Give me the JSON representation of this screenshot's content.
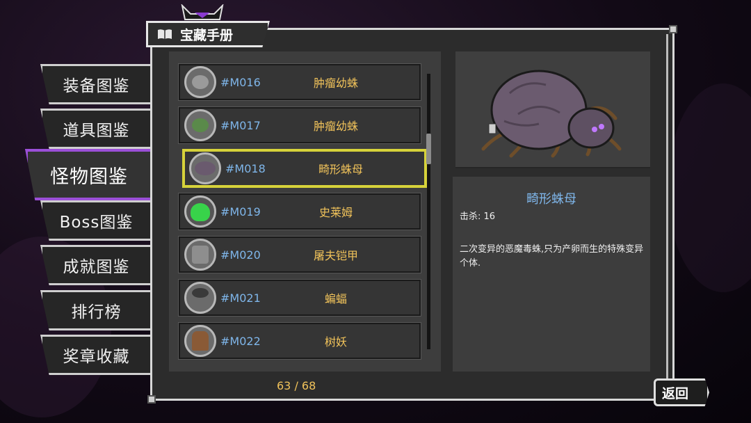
{
  "header": {
    "title": "宝藏手册",
    "icon": "book-icon"
  },
  "sidebar": {
    "items": [
      {
        "label": "装备图鉴",
        "active": false
      },
      {
        "label": "道具图鉴",
        "active": false
      },
      {
        "label": "怪物图鉴",
        "active": true
      },
      {
        "label": "Boss图鉴",
        "active": false
      },
      {
        "label": "成就图鉴",
        "active": false
      },
      {
        "label": "排行榜",
        "active": false
      },
      {
        "label": "奖章收藏",
        "active": false
      }
    ]
  },
  "monster_list": [
    {
      "id": "#M016",
      "name": "肿瘤幼蛛",
      "icon": "small-spider-icon",
      "color": "#9a9a9a"
    },
    {
      "id": "#M017",
      "name": "肿瘤幼蛛",
      "icon": "green-spider-icon",
      "color": "#5a8a4a"
    },
    {
      "id": "#M018",
      "name": "畸形蛛母",
      "icon": "spider-mother-icon",
      "color": "#6a5a6e",
      "selected": true
    },
    {
      "id": "#M019",
      "name": "史莱姆",
      "icon": "slime-icon",
      "color": "#38d34a"
    },
    {
      "id": "#M020",
      "name": "屠夫铠甲",
      "icon": "butcher-armor-icon",
      "color": "#8e8e8e"
    },
    {
      "id": "#M021",
      "name": "蝙蝠",
      "icon": "bat-icon",
      "color": "#3a3a3a"
    },
    {
      "id": "#M022",
      "name": "树妖",
      "icon": "treant-icon",
      "color": "#8a5a36"
    }
  ],
  "pagination": {
    "text": "63 / 68"
  },
  "detail": {
    "name": "畸形蛛母",
    "kills": "击杀: 16",
    "description": "二次变异的恶魔毒蛛,只为产卵而生的特殊变异个体."
  },
  "back_button": {
    "label": "返回"
  },
  "colors": {
    "accent_purple": "#9b4fd8",
    "id_blue": "#7fb6ea",
    "name_gold": "#f0c25a",
    "selected_yellow": "#d6d23a"
  }
}
